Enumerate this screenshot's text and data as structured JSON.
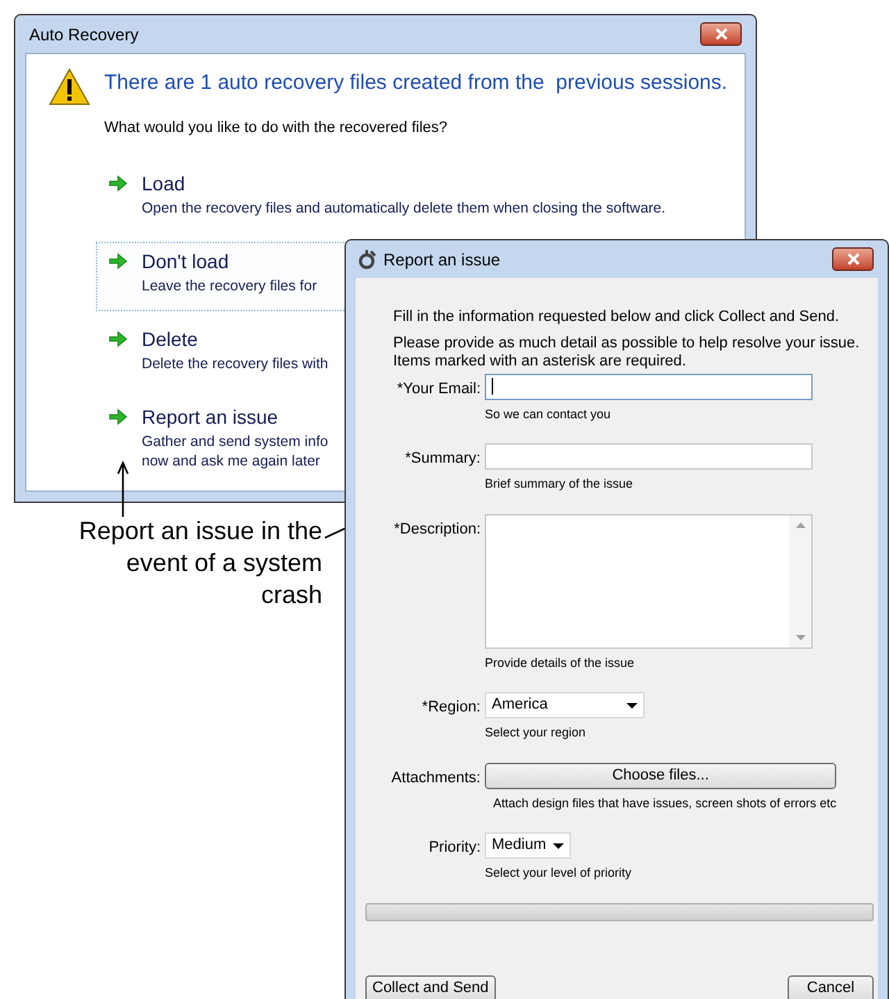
{
  "recovery_window": {
    "title": "Auto Recovery",
    "heading": "There are 1 auto recovery files created from the  previous sessions.",
    "question": "What would you like to do with the recovered files?",
    "options": [
      {
        "title": "Load",
        "description": [
          "Open the recovery files and automatically delete them when closing the software."
        ],
        "selected": false
      },
      {
        "title": "Don't load",
        "description": [
          "Leave the recovery files for"
        ],
        "selected": true
      },
      {
        "title": "Delete",
        "description": [
          "Delete the recovery files with"
        ],
        "selected": false
      },
      {
        "title": "Report an issue",
        "description": [
          "Gather and send system info",
          "now and ask me again later"
        ],
        "selected": false
      }
    ]
  },
  "callout": {
    "text": "Report an issue in the event of a system crash"
  },
  "report_window": {
    "title": "Report an issue",
    "intro": "Fill in the information requested below and click Collect and Send.",
    "instructions": [
      "Please provide as much detail as possible to help resolve your issue.",
      "Items marked with an asterisk are required."
    ],
    "fields": [
      {
        "kind": "text",
        "label": "*Your Email:",
        "hint": "So we can contact you",
        "focused": true
      },
      {
        "kind": "text",
        "label": "*Summary:",
        "hint": "Brief summary of the issue",
        "focused": false
      },
      {
        "kind": "textarea",
        "label": "*Description:",
        "hint": "Provide details of the issue",
        "focused": false
      },
      {
        "kind": "select",
        "label": "*Region:",
        "value": "America",
        "hint": "Select your region",
        "focused": false
      },
      {
        "kind": "button",
        "label": "Attachments:",
        "value": "Choose files...",
        "hint": "Attach design files that have issues, screen shots of errors etc",
        "focused": false
      },
      {
        "kind": "select-small",
        "label": "Priority:",
        "value": "Medium",
        "hint": "Select your level of priority",
        "focused": false
      }
    ],
    "progress": {
      "level": 0
    },
    "buttons": [
      "Collect and Send",
      "Cancel"
    ]
  }
}
